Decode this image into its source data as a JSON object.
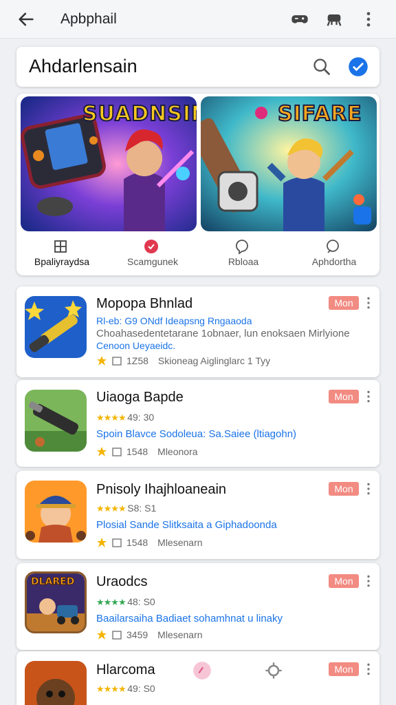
{
  "topbar": {
    "title": "Apbphail",
    "icons": [
      "back-arrow-icon",
      "gamepad-icon",
      "controller-icon",
      "more-vert-icon"
    ]
  },
  "search": {
    "query": "Ahdarlensain",
    "icons": [
      "search-icon",
      "verified-check-icon"
    ]
  },
  "featured": {
    "banners": [
      {
        "title": "SUADNSIN"
      },
      {
        "title": "SIFARE"
      }
    ],
    "tabs": [
      {
        "label": "Bpaliyraydsa",
        "icon": "grid-icon",
        "active": true
      },
      {
        "label": "Scamgunek",
        "icon": "heart-icon",
        "active": false
      },
      {
        "label": "Rbloaa",
        "icon": "chat-bubble-icon",
        "active": false
      },
      {
        "label": "Aphdortha",
        "icon": "comment-icon",
        "active": false
      }
    ]
  },
  "items": [
    {
      "name": "Mopopa Bhnlad",
      "badge": "Mon",
      "line1": "Rl-eb: G9 ONdf Ideapsng Rngaaoda",
      "line2": "Choahasedentetarane 1obnaer, lun enoksaen Mirlyione",
      "line3": "Cenoon Ueyaeidc.",
      "num": "1Z58",
      "meta": "Skioneag Aiglinglarc  1 Tyy"
    },
    {
      "name": "Uiaoga Bapde",
      "badge": "Mon",
      "rating": "49: 30",
      "desc": "Spoin Blavce Sodoleua: Sa.Saiee (ltiagohn)",
      "num": "1548",
      "meta": "Mleonora"
    },
    {
      "name": "Pnisoly Ihajhloaneain",
      "badge": "Mon",
      "rating": "S8: S1",
      "desc": "Plosial Sande Slitksaita a Giphadoonda",
      "num": "1548",
      "meta": "Mlesenarn"
    },
    {
      "name": "Uraodcs",
      "badge": "Mon",
      "rating": "48: S0",
      "desc": "Baailarsaiha Badiaet sohamhnat u linaky",
      "num": "3459",
      "meta": "Mlesenarn",
      "thumb_text": "DLARED"
    },
    {
      "name": "Hlarcoma",
      "badge": "Mon",
      "rating": "49: S0"
    }
  ],
  "colors": {
    "accent": "#1a73e8",
    "badge": "#f28b82",
    "star": "#f4b400",
    "background": "#eef0f3"
  }
}
